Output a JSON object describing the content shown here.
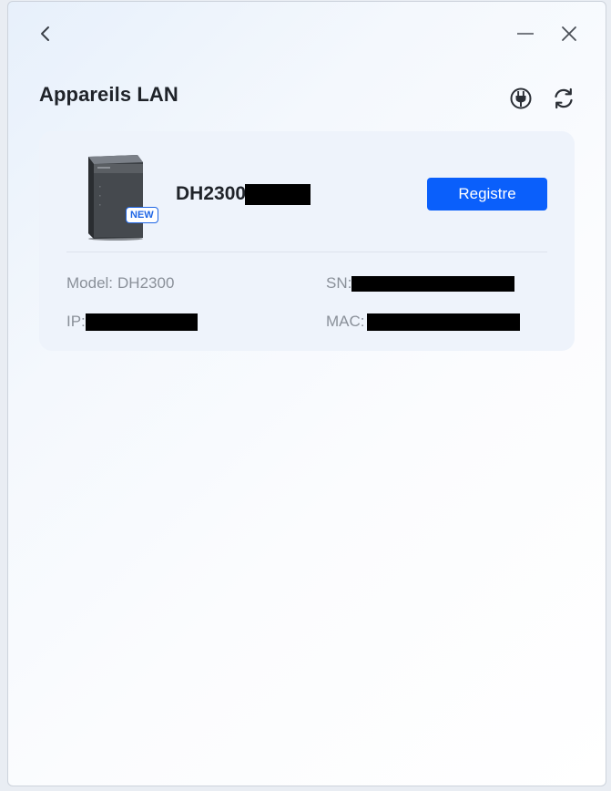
{
  "header": {
    "title": "Appareils LAN"
  },
  "window_controls": {
    "back_icon": "chevron-left-icon",
    "minimize_icon": "minimize-icon",
    "close_icon": "close-icon"
  },
  "toolbar": {
    "plug_icon": "plug-icon",
    "refresh_icon": "refresh-icon"
  },
  "device": {
    "name": "DH2300",
    "badge": "NEW",
    "register_label": "Registre",
    "model_label": "Model:",
    "model_value": "DH2300",
    "sn_label": "SN:",
    "ip_label": "IP:",
    "mac_label": "MAC:"
  },
  "colors": {
    "accent": "#0a5ffb",
    "badge": "#1f66e5",
    "card_bg": "#eef3fb",
    "title_text": "#1f2329",
    "muted_text": "#8a9099"
  }
}
